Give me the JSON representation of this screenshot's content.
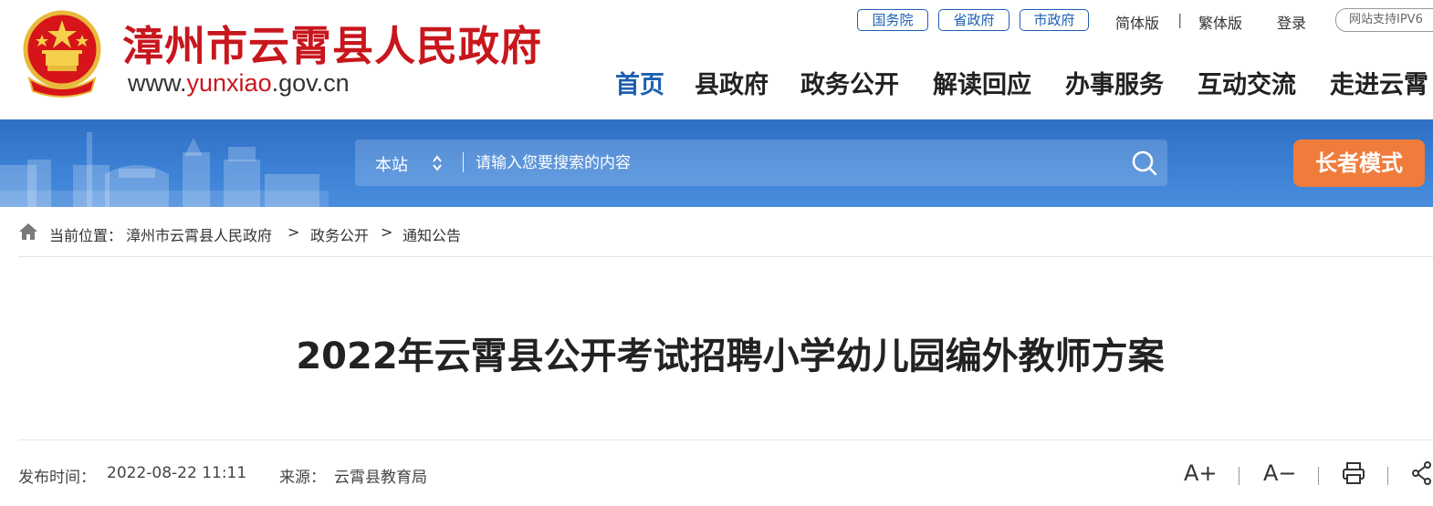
{
  "header": {
    "site_title": "漳州市云霄县人民政府",
    "url_prefix": "www.",
    "url_highlight": "yunxiao",
    "url_suffix": ".gov.cn",
    "gov_links": [
      "国务院",
      "省政府",
      "市政府"
    ],
    "lang_simplified": "简体版",
    "lang_sep": "|",
    "lang_traditional": "繁体版",
    "login": "登录",
    "ipv6_badge": "网站支持IPV6"
  },
  "nav": {
    "items": [
      "首页",
      "县政府",
      "政务公开",
      "解读回应",
      "办事服务",
      "互动交流",
      "走进云霄"
    ],
    "active_index": 0
  },
  "search": {
    "scope": "本站",
    "placeholder": "请输入您要搜索的内容",
    "icon": "search-icon"
  },
  "elder_mode": "长者模式",
  "breadcrumb": {
    "prefix": "当前位置：",
    "items": [
      "漳州市云霄县人民政府",
      "政务公开",
      "通知公告"
    ],
    "separator": ">"
  },
  "article": {
    "title": "2022年云霄县公开考试招聘小学幼儿园编外教师方案",
    "publish_label": "发布时间：",
    "publish_time": "2022-08-22 11:11",
    "source_label": "来源：",
    "source": "云霄县教育局"
  },
  "tools": {
    "font_increase": "A+",
    "font_decrease": "A−"
  },
  "colors": {
    "brand_red": "#c8161d",
    "nav_blue": "#1d5fb0",
    "banner_blue": "#3d82d6",
    "elder_orange": "#f07c3b"
  }
}
